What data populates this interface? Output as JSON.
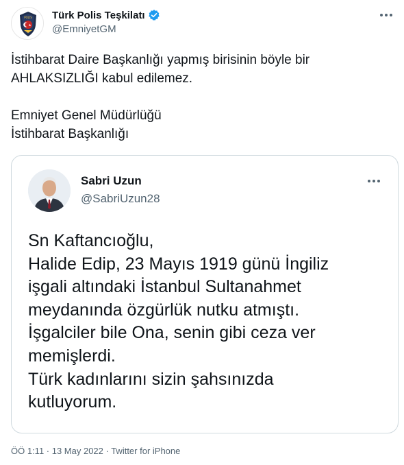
{
  "author": {
    "display_name": "Türk Polis Teşkilatı",
    "handle": "@EmniyetGM",
    "verified_icon": "verified-badge-icon",
    "accent": "#1d9bf0"
  },
  "tweet": {
    "lines": [
      "İstihbarat Daire Başkanlığı yapmış birisinin böyle bir",
      "AHLAKSIZLIĞI kabul edilemez.",
      "",
      "Emniyet Genel Müdürlüğü",
      "İstihbarat Başkanlığı"
    ]
  },
  "quoted": {
    "display_name": "Sabri Uzun",
    "handle": "@SabriUzun28",
    "lines": [
      "Sn Kaftancıoğlu,",
      "Halide Edip, 23 Mayıs 1919 günü İngiliz",
      "işgali altındaki İstanbul Sultanahmet",
      "meydanında özgürlük nutku atmıştı.",
      "İşgalciler bile Ona, senin gibi ceza ver",
      "memişlerdi.",
      "Türk kadınlarını sizin şahsınızda",
      "kutluyorum."
    ]
  },
  "meta": {
    "text": "ÖÖ 1:11 · 13 May 2022 · Twitter for iPhone"
  }
}
